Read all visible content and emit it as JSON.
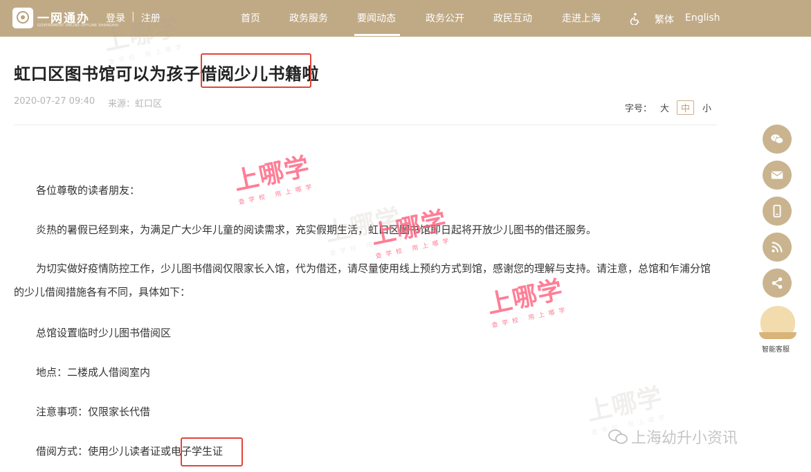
{
  "header": {
    "logo_title": "一网通办",
    "logo_subtitle": "GOVERNMENT ONLINE-OFFLINE SHANGHAI",
    "login": "登录",
    "separator": "|",
    "register": "注册",
    "nav": [
      "首页",
      "政务服务",
      "要闻动态",
      "政务公开",
      "政民互动",
      "走进上海"
    ],
    "active_nav": "要闻动态",
    "lang_traditional": "繁体",
    "lang_english": "English",
    "accent_color": "#c0aa86"
  },
  "article": {
    "title": "虹口区图书馆可以为孩子借阅少儿书籍啦",
    "date": "2020-07-27 09:40",
    "source": "来源：虹口区",
    "font_size_label": "字号：",
    "font_size_options": [
      "大",
      "中",
      "小"
    ],
    "font_size_selected": "中",
    "paragraphs": [
      "各位尊敬的读者朋友：",
      "炎热的暑假已经到来，为满足广大少年儿童的阅读需求，充实假期生活，虹口区图书馆即日起将开放少儿图书的借还服务。",
      "为切实做好疫情防控工作，少儿图书借阅仅限家长入馆，代为借还，请尽量使用线上预约方式到馆，感谢您的理解与支持。请注意，总馆和乍浦分馆的少儿借阅措施各有不同，具体如下：",
      "总馆设置临时少儿图书借阅区",
      "地点：二楼成人借阅室内",
      "注意事项：仅限家长代借",
      "借阅方式：使用少儿读者证或电子学生证"
    ]
  },
  "sidebar": {
    "buttons": [
      "wechat-icon",
      "mail-icon",
      "mobile-icon",
      "rss-icon",
      "share-icon"
    ],
    "assistant_label": "智能客服"
  },
  "watermarks": {
    "main": "上哪学",
    "sub": "查学校 用上哪学",
    "brand": "上海幼升小资讯"
  }
}
